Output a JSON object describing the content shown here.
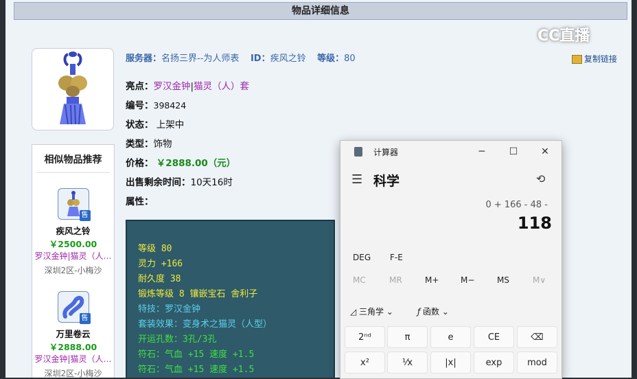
{
  "page": {
    "title": "物品详细信息",
    "watermark": "CC直播",
    "meta": {
      "server_label": "服务器：",
      "server_value": "名扬三界--为人师表",
      "id_label": "ID：",
      "id_value": "疾风之铃",
      "level_label": "等级：",
      "level_value": "80"
    },
    "copy_link": "复制链接",
    "rows": {
      "highlight_label": "亮点：",
      "highlight_a": "罗汉金钟",
      "highlight_sep": "|",
      "highlight_b": "猫灵（人）套",
      "number_label": "编号：",
      "number_value": "398424",
      "status_label": "状态：",
      "status_value": "上架中",
      "type_label": "类型：",
      "type_value": "饰物",
      "price_label": "价格：",
      "price_value": "￥2888.00（元）",
      "remain_label": "出售剩余时间：",
      "remain_value": "10天16时",
      "attr_label": "属性："
    },
    "attributes": [
      {
        "text": "等级 80",
        "color": "yellow"
      },
      {
        "text": "灵力 +166",
        "color": "yellow"
      },
      {
        "text": "耐久度 38",
        "color": "yellow"
      },
      {
        "text": "锻炼等级 8 镶嵌宝石 舍利子",
        "color": "yellow"
      },
      {
        "text": "特技：罗汉金钟",
        "color": "cyan"
      },
      {
        "text": "套装效果：变身术之猫灵（人型）",
        "color": "cyan"
      },
      {
        "text": "开运孔数：3孔/3孔",
        "color": "green"
      },
      {
        "text": "符石：气血 +15 速度 +1.5",
        "color": "green"
      },
      {
        "text": "符石：气血 +15 速度 +1.5",
        "color": "green"
      }
    ],
    "similar": {
      "header": "相似物品推荐",
      "items": [
        {
          "name": "疾风之铃",
          "price": "￥2500.00",
          "tag": "罗汉金钟|猫灵（人…",
          "server": "深圳2区-小梅沙",
          "badge": "售"
        },
        {
          "name": "万里卷云",
          "price": "￥2888.00",
          "tag": "罗汉金钟|猫灵（人…",
          "server": "深圳2区-小梅沙",
          "badge": "售"
        }
      ]
    }
  },
  "calculator": {
    "app_name": "计算器",
    "mode": "科学",
    "expression": "0 + 166 - 48 -",
    "result": "118",
    "deg": "DEG",
    "fe": "F-E",
    "memory": [
      "MC",
      "MR",
      "M+",
      "M−",
      "MS",
      "M∨"
    ],
    "trig": "三角学",
    "func": "函数",
    "keys_row1": [
      "2ⁿᵈ",
      "π",
      "e",
      "CE",
      "⌫"
    ],
    "keys_row2": [
      "x²",
      "¹⁄x",
      "|x|",
      "exp",
      "mod"
    ]
  },
  "colors": {
    "yellow": "#f0ea3a",
    "cyan": "#5cd0e8",
    "green": "#40e040",
    "purple": "#9c2aa8",
    "price_green": "#1a9a1a"
  }
}
